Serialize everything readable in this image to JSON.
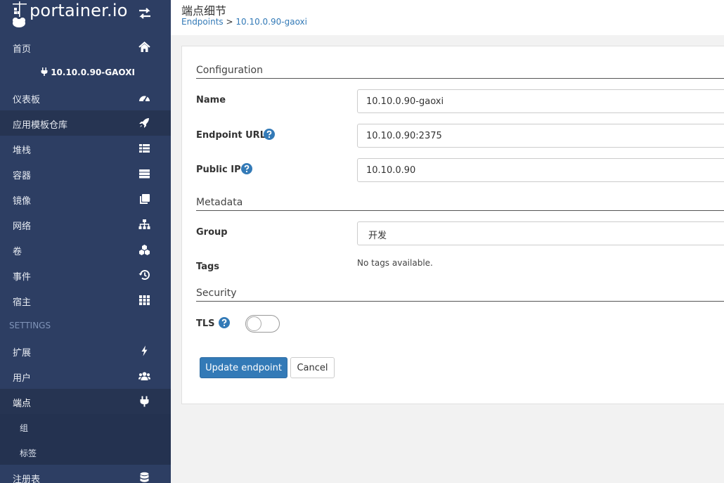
{
  "brand": {
    "name": "portainer.io",
    "logo_icon": "whale-crane-icon",
    "toggle_icon": "exchange-icon"
  },
  "sidebar": {
    "home": "首页",
    "endpoint_name": "10.10.0.90-GAOXI",
    "items": [
      {
        "label": "仪表板",
        "icon": "dashboard-icon"
      },
      {
        "label": "应用模板仓库",
        "icon": "rocket-icon"
      },
      {
        "label": "堆栈",
        "icon": "stack-list-icon"
      },
      {
        "label": "容器",
        "icon": "server-icon"
      },
      {
        "label": "镜像",
        "icon": "clone-icon"
      },
      {
        "label": "网络",
        "icon": "sitemap-icon"
      },
      {
        "label": "卷",
        "icon": "cubes-icon"
      },
      {
        "label": "事件",
        "icon": "history-icon"
      },
      {
        "label": "宿主",
        "icon": "grid-icon"
      }
    ],
    "settings_title": "SETTINGS",
    "settings_items": [
      {
        "label": "扩展",
        "icon": "bolt-icon"
      },
      {
        "label": "用户",
        "icon": "users-icon"
      },
      {
        "label": "端点",
        "icon": "plug-icon"
      }
    ],
    "sub_items": [
      "组",
      "标签"
    ],
    "registries": {
      "label": "注册表",
      "icon": "database-icon"
    }
  },
  "header": {
    "title": "端点细节",
    "breadcrumb": {
      "link": "Endpoints",
      "separator": ">",
      "current": "10.10.0.90-gaoxi"
    }
  },
  "form": {
    "configuration_title": "Configuration",
    "name_label": "Name",
    "name_value": "10.10.0.90-gaoxi",
    "url_label": "Endpoint URL",
    "url_value": "10.10.0.90:2375",
    "public_ip_label": "Public IP",
    "public_ip_value": "10.10.0.90",
    "metadata_title": "Metadata",
    "group_label": "Group",
    "group_value": "开发",
    "tags_label": "Tags",
    "tags_value": "No tags available.",
    "security_title": "Security",
    "tls_label": "TLS",
    "tls_enabled": false,
    "update_button": "Update endpoint",
    "cancel_button": "Cancel"
  },
  "colors": {
    "sidebar_bg": "#2d3e63",
    "primary": "#337ab7",
    "link": "#337ab7"
  }
}
